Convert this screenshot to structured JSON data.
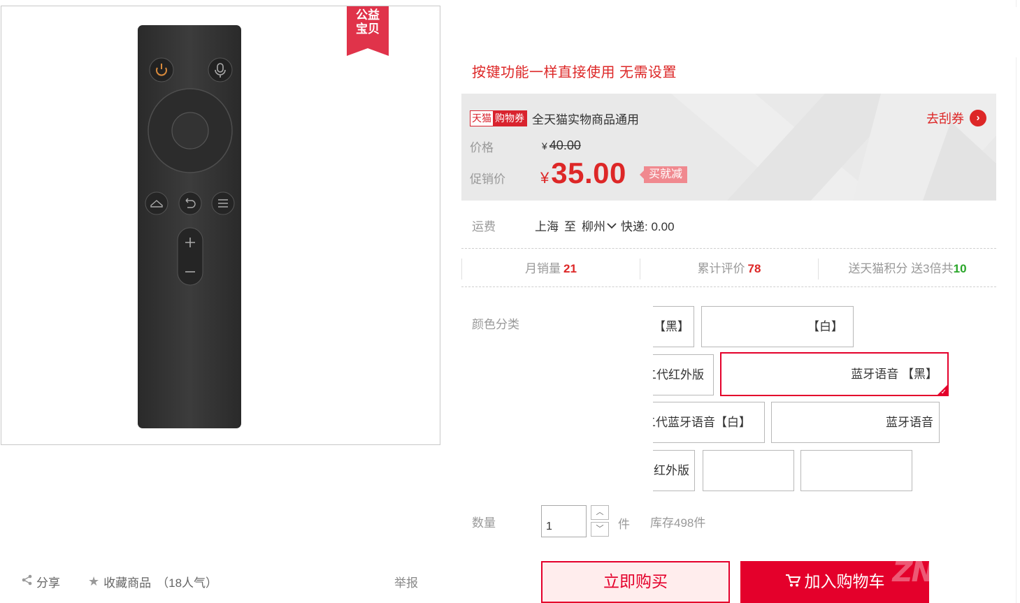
{
  "badge": {
    "line1": "公益",
    "line2": "宝贝"
  },
  "actions": {
    "share": "分享",
    "favorite": "收藏商品",
    "popularity": "（18人气）",
    "report": "举报"
  },
  "product": {
    "subtitle": "按键功能一样直接使用 无需设置"
  },
  "coupon": {
    "tag_left": "天猫",
    "tag_right": "购物券",
    "text": "全天猫实物商品通用",
    "link": "去刮券"
  },
  "price": {
    "label": "价格",
    "currency": "¥",
    "original": "40.00",
    "promo_label": "促销价",
    "promo": "35.00",
    "promo_tag": "买就减"
  },
  "shipping": {
    "label": "运费",
    "from": "上海",
    "to_word": "至",
    "to": "柳州",
    "method": "快递: 0.00"
  },
  "stats": {
    "monthly_label": "月销量",
    "monthly": "21",
    "reviews_label": "累计评价",
    "reviews": "78",
    "points_label": "送天猫积分 送3倍共",
    "points": "10"
  },
  "sku": {
    "label": "颜色分类",
    "options": [
      "【黑】",
      "【白】",
      "二代红外版",
      "蓝牙语音 【黑】",
      "二代蓝牙语音【白】",
      "蓝牙语音",
      "红外版",
      "",
      ""
    ],
    "selected_index": 3
  },
  "quantity": {
    "label": "数量",
    "value": "1",
    "unit": "件",
    "stock": "库存498件"
  },
  "buttons": {
    "buy_now": "立即购买",
    "add_cart": "加入购物车"
  },
  "colors": {
    "accent": "#e4002b",
    "price_red": "#dd2727",
    "panel_bg": "#e9e9e9"
  }
}
